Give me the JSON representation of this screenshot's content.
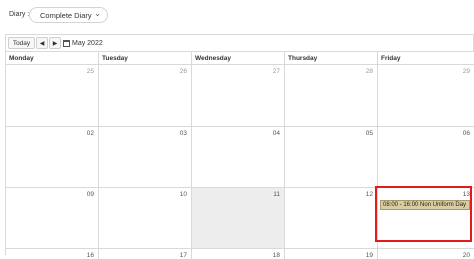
{
  "diary": {
    "label": "Diary :",
    "selected": "Complete Diary"
  },
  "toolbar": {
    "today_label": "Today",
    "prev_label": "◀",
    "next_label": "▶",
    "current_period": "May 2022"
  },
  "calendar": {
    "weekdays": [
      "Monday",
      "Tuesday",
      "Wednesday",
      "Thursday",
      "Friday"
    ],
    "weeks": [
      [
        "25",
        "26",
        "27",
        "28",
        "29"
      ],
      [
        "02",
        "03",
        "04",
        "05",
        "06"
      ],
      [
        "09",
        "10",
        "11",
        "12",
        "13"
      ],
      [
        "16",
        "17",
        "18",
        "19",
        "20"
      ]
    ],
    "today": "11"
  },
  "event": {
    "text": "08:00 - 16:00 Non Uniform Day",
    "color": "#d8cca0"
  },
  "highlight_color": "#e41b1b"
}
